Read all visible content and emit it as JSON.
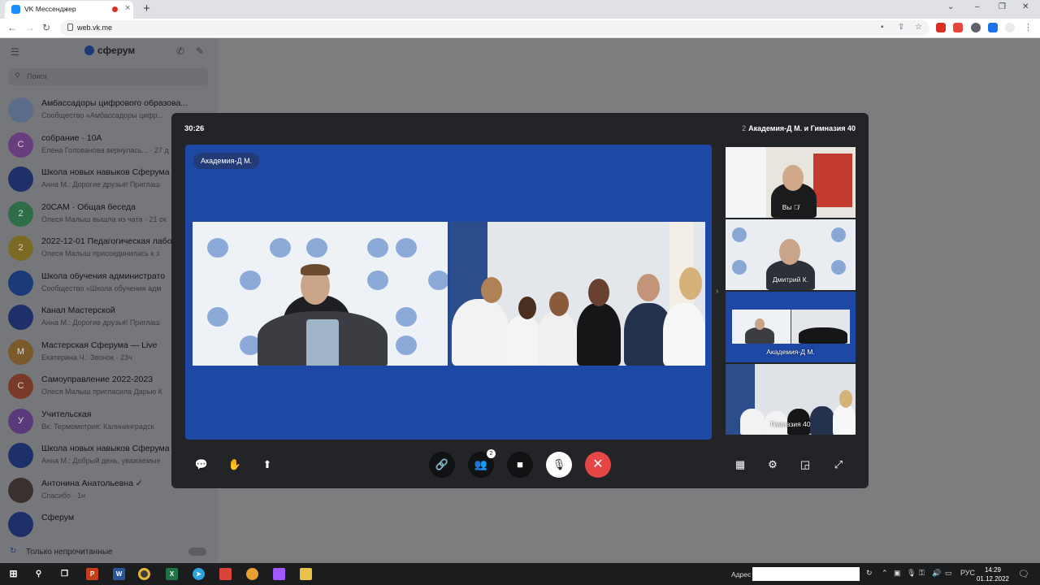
{
  "browser": {
    "tab_title": "VK Мессенджер",
    "new_tab": "+",
    "url": "web.vk.me",
    "close_tab": "×",
    "win_min": "⌄",
    "win_minimize": "–",
    "win_restore": "❐",
    "win_close": "✕"
  },
  "sidebar": {
    "brand": "сферум",
    "search_placeholder": "Поиск",
    "chats": [
      {
        "name": "Амбассадоры цифрового образова...",
        "preview": "Сообщество «Амбассадоры цифр...",
        "avatar": "",
        "color": "#5b6b8a"
      },
      {
        "name": "собрание · 10А",
        "preview": "Елена Голованова вернулась... · 27 д",
        "avatar": "С",
        "color": "#6a3e7e"
      },
      {
        "name": "Школа новых навыков Сферума",
        "preview": "Анна М.: Дорогие друзья! Приглаш",
        "avatar": "",
        "color": "#1e3069"
      },
      {
        "name": "20САМ · Общая беседа",
        "preview": "Олеся Малыш вышла из чата · 21 ок",
        "avatar": "2",
        "color": "#2e6d48"
      },
      {
        "name": "2022-12-01 Педагогическая лабо",
        "preview": "Олеся Малыш присоединилась к з",
        "avatar": "2",
        "color": "#7a6a24"
      },
      {
        "name": "Школа обучения администрато",
        "preview": "Сообщество «Школа обучения адм",
        "avatar": "",
        "color": "#1a3a7a"
      },
      {
        "name": "Канал Мастерской",
        "preview": "Анна М.: Дорогие друзья! Приглаш",
        "avatar": "",
        "color": "#1e3069"
      },
      {
        "name": "Мастерская Сферума — Live",
        "preview": "Екатерина Ч.: Звонок · 23ч",
        "avatar": "М",
        "color": "#7a5a2a"
      },
      {
        "name": "Самоуправление 2022-2023",
        "preview": "Олеся Малыш пригласила Дарью К",
        "avatar": "С",
        "color": "#7a3a2a"
      },
      {
        "name": "Учительская",
        "preview": "Вк: Термометрия: Калининградск",
        "avatar": "У",
        "color": "#5a3a7a"
      },
      {
        "name": "Школа новых навыков Сферума",
        "preview": "Анна М.: Добрый день, уважаемые",
        "avatar": "",
        "color": "#1e3069"
      },
      {
        "name": "Антонина Анатольевна ✓",
        "preview": "Спасибо · 1н",
        "avatar": "",
        "color": "#3a3030"
      },
      {
        "name": "Сферум",
        "preview": "",
        "avatar": "",
        "color": "#1e3069"
      }
    ],
    "footer_label": "Только непрочитанные"
  },
  "call": {
    "timer": "30:26",
    "participants_count": "2",
    "title": "Академия-Д М. и Гимназия 40",
    "main_speaker": "Академия-Д М.",
    "thumbnails": [
      {
        "label": "Вы",
        "muted": true
      },
      {
        "label": "Дмитрий К."
      },
      {
        "label": "Академия-Д М.",
        "active": true
      },
      {
        "label": "Гимназия 40"
      }
    ],
    "participants_badge": "2"
  },
  "taskbar": {
    "address_label": "Адрес",
    "lang": "РУС",
    "time": "14:29",
    "date": "01.12.2022"
  },
  "colors": {
    "stage_blue": "#1d48a6",
    "end_call_red": "#e64646",
    "call_bg": "#232427"
  }
}
